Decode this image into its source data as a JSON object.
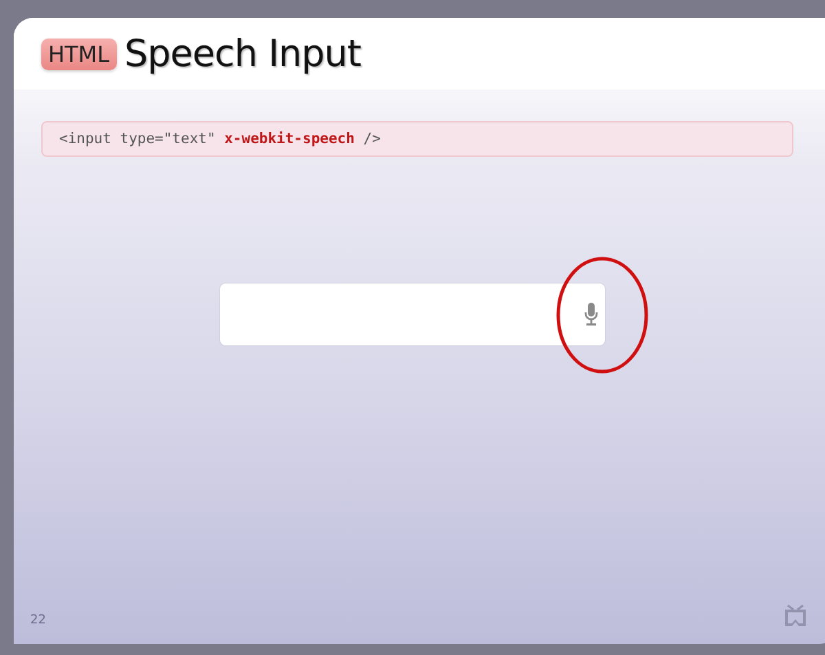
{
  "slide": {
    "badge": "HTML",
    "title": "Speech Input",
    "code": [
      {
        "kind": "plain",
        "text": "<input type=\"text\" "
      },
      {
        "kind": "attr",
        "text": "x-webkit-speech"
      },
      {
        "kind": "plain",
        "text": " />"
      }
    ],
    "demo": {
      "kind": "speech-input",
      "highlighted": true
    },
    "page_number": "22"
  }
}
